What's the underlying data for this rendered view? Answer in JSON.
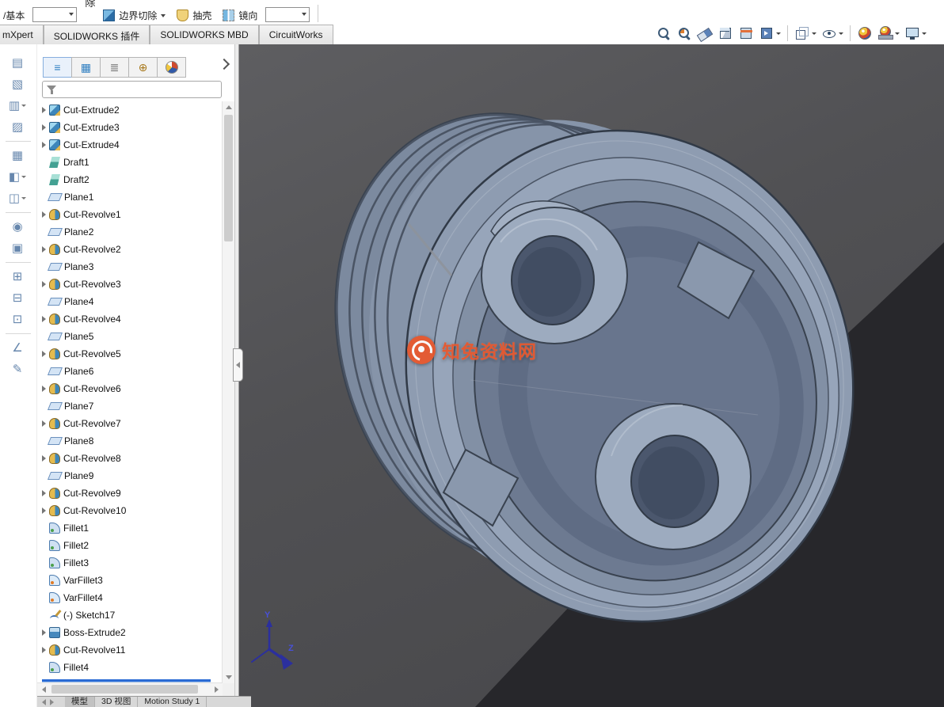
{
  "colors": {
    "accent_blue": "#2a6bd4",
    "watermark_orange": "#e8582e",
    "viewport_gray": "#515154",
    "model_steel": "#8e9cb1"
  },
  "top_toolbar": {
    "left_fragment": "/基本",
    "clipped_fragment": "除",
    "buttons": [
      {
        "label": "边界切除",
        "icon": "boundary-cut",
        "caret": true
      },
      {
        "label": "抽壳",
        "icon": "shell",
        "caret": false
      },
      {
        "label": "镜向",
        "icon": "mirror",
        "caret": false
      }
    ]
  },
  "ribbon_tabs": [
    {
      "label": "mXpert",
      "clipped": true
    },
    {
      "label": "SOLIDWORKS 插件",
      "clipped": false
    },
    {
      "label": "SOLIDWORKS MBD",
      "clipped": false
    },
    {
      "label": "CircuitWorks",
      "clipped": false
    }
  ],
  "view_toolbar": [
    {
      "name": "zoom-fit",
      "caret": false,
      "sep": false
    },
    {
      "name": "zoom-area",
      "caret": false,
      "sep": false
    },
    {
      "name": "previous-view",
      "caret": false,
      "sep": false
    },
    {
      "name": "view-orientation",
      "caret": false,
      "sep": false
    },
    {
      "name": "section-view",
      "caret": false,
      "sep": false
    },
    {
      "name": "3d-drawing-view",
      "caret": true,
      "sep": false
    },
    {
      "name": "display-style",
      "caret": true,
      "sep": true
    },
    {
      "name": "hide-show-items",
      "caret": true,
      "sep": false
    },
    {
      "name": "edit-appearance",
      "caret": false,
      "sep": true
    },
    {
      "name": "apply-scene",
      "caret": true,
      "sep": false
    },
    {
      "name": "view-settings",
      "caret": true,
      "sep": false
    }
  ],
  "left_toolbar": [
    {
      "name": "notes-tool",
      "glyph": "▤",
      "caret": false,
      "sep": false
    },
    {
      "name": "clip-tool",
      "glyph": "▧",
      "caret": false,
      "sep": false
    },
    {
      "name": "layout-tool",
      "glyph": "▥",
      "caret": true,
      "sep": false
    },
    {
      "name": "edit-notes-tool",
      "glyph": "▨",
      "caret": false,
      "sep": false
    },
    {
      "name": "image-tool",
      "glyph": "▦",
      "caret": false,
      "sep": true
    },
    {
      "name": "export-tool",
      "glyph": "◧",
      "caret": true,
      "sep": false
    },
    {
      "name": "model-view-tool",
      "glyph": "◫",
      "caret": true,
      "sep": false
    },
    {
      "name": "material-tool",
      "glyph": "◉",
      "caret": false,
      "sep": true
    },
    {
      "name": "table-tool",
      "glyph": "▣",
      "caret": false,
      "sep": false
    },
    {
      "name": "component-tool",
      "glyph": "⊞",
      "caret": false,
      "sep": true
    },
    {
      "name": "grid-tool",
      "glyph": "⊟",
      "caret": false,
      "sep": false
    },
    {
      "name": "block-tool",
      "glyph": "⊡",
      "caret": false,
      "sep": false
    },
    {
      "name": "dimension-tool",
      "glyph": "∠",
      "caret": false,
      "sep": true
    },
    {
      "name": "sketch-pencil-tool",
      "glyph": "✎",
      "caret": false,
      "sep": false
    }
  ],
  "feature_panel": {
    "tabs": [
      {
        "name": "featuremanager-tab",
        "glyph": "≡"
      },
      {
        "name": "propertymanager-tab",
        "glyph": "▦"
      },
      {
        "name": "configurationmanager-tab",
        "glyph": "≣"
      },
      {
        "name": "dimxpertmanager-tab",
        "glyph": "⊕"
      },
      {
        "name": "displaymanager-tab",
        "glyph": "ball"
      }
    ],
    "tree": [
      {
        "label": "Cut-Extrude2",
        "icon": "cut-extrude",
        "exp": true
      },
      {
        "label": "Cut-Extrude3",
        "icon": "cut-extrude",
        "exp": true
      },
      {
        "label": "Cut-Extrude4",
        "icon": "cut-extrude",
        "exp": true
      },
      {
        "label": "Draft1",
        "icon": "draft",
        "exp": false
      },
      {
        "label": "Draft2",
        "icon": "draft",
        "exp": false
      },
      {
        "label": "Plane1",
        "icon": "plane",
        "exp": false
      },
      {
        "label": "Cut-Revolve1",
        "icon": "cut-revolve",
        "exp": true
      },
      {
        "label": "Plane2",
        "icon": "plane",
        "exp": false
      },
      {
        "label": "Cut-Revolve2",
        "icon": "cut-revolve",
        "exp": true
      },
      {
        "label": "Plane3",
        "icon": "plane",
        "exp": false
      },
      {
        "label": "Cut-Revolve3",
        "icon": "cut-revolve",
        "exp": true
      },
      {
        "label": "Plane4",
        "icon": "plane",
        "exp": false
      },
      {
        "label": "Cut-Revolve4",
        "icon": "cut-revolve",
        "exp": true
      },
      {
        "label": "Plane5",
        "icon": "plane",
        "exp": false
      },
      {
        "label": "Cut-Revolve5",
        "icon": "cut-revolve",
        "exp": true
      },
      {
        "label": "Plane6",
        "icon": "plane",
        "exp": false
      },
      {
        "label": "Cut-Revolve6",
        "icon": "cut-revolve",
        "exp": true
      },
      {
        "label": "Plane7",
        "icon": "plane",
        "exp": false
      },
      {
        "label": "Cut-Revolve7",
        "icon": "cut-revolve",
        "exp": true
      },
      {
        "label": "Plane8",
        "icon": "plane",
        "exp": false
      },
      {
        "label": "Cut-Revolve8",
        "icon": "cut-revolve",
        "exp": true
      },
      {
        "label": "Plane9",
        "icon": "plane",
        "exp": false
      },
      {
        "label": "Cut-Revolve9",
        "icon": "cut-revolve",
        "exp": true
      },
      {
        "label": "Cut-Revolve10",
        "icon": "cut-revolve",
        "exp": true
      },
      {
        "label": "Fillet1",
        "icon": "fillet",
        "exp": false
      },
      {
        "label": "Fillet2",
        "icon": "fillet",
        "exp": false
      },
      {
        "label": "Fillet3",
        "icon": "fillet",
        "exp": false
      },
      {
        "label": "VarFillet3",
        "icon": "varfillet",
        "exp": false
      },
      {
        "label": "VarFillet4",
        "icon": "varfillet",
        "exp": false
      },
      {
        "label": "(-) Sketch17",
        "icon": "sketch",
        "exp": false
      },
      {
        "label": "Boss-Extrude2",
        "icon": "boss-extrude",
        "exp": true
      },
      {
        "label": "Cut-Revolve11",
        "icon": "cut-revolve",
        "exp": true
      },
      {
        "label": "Fillet4",
        "icon": "fillet",
        "exp": false
      }
    ]
  },
  "viewport": {
    "watermark_text": "知兔资料网",
    "triad": {
      "y": "Y",
      "z": "Z"
    }
  },
  "bottom_tabs": [
    {
      "name": "model-tab",
      "label": "模型",
      "active": true
    },
    {
      "name": "3d-views-tab",
      "label": "3D 视图",
      "active": false
    },
    {
      "name": "motion-study-tab",
      "label": "Motion Study 1",
      "active": false
    }
  ]
}
